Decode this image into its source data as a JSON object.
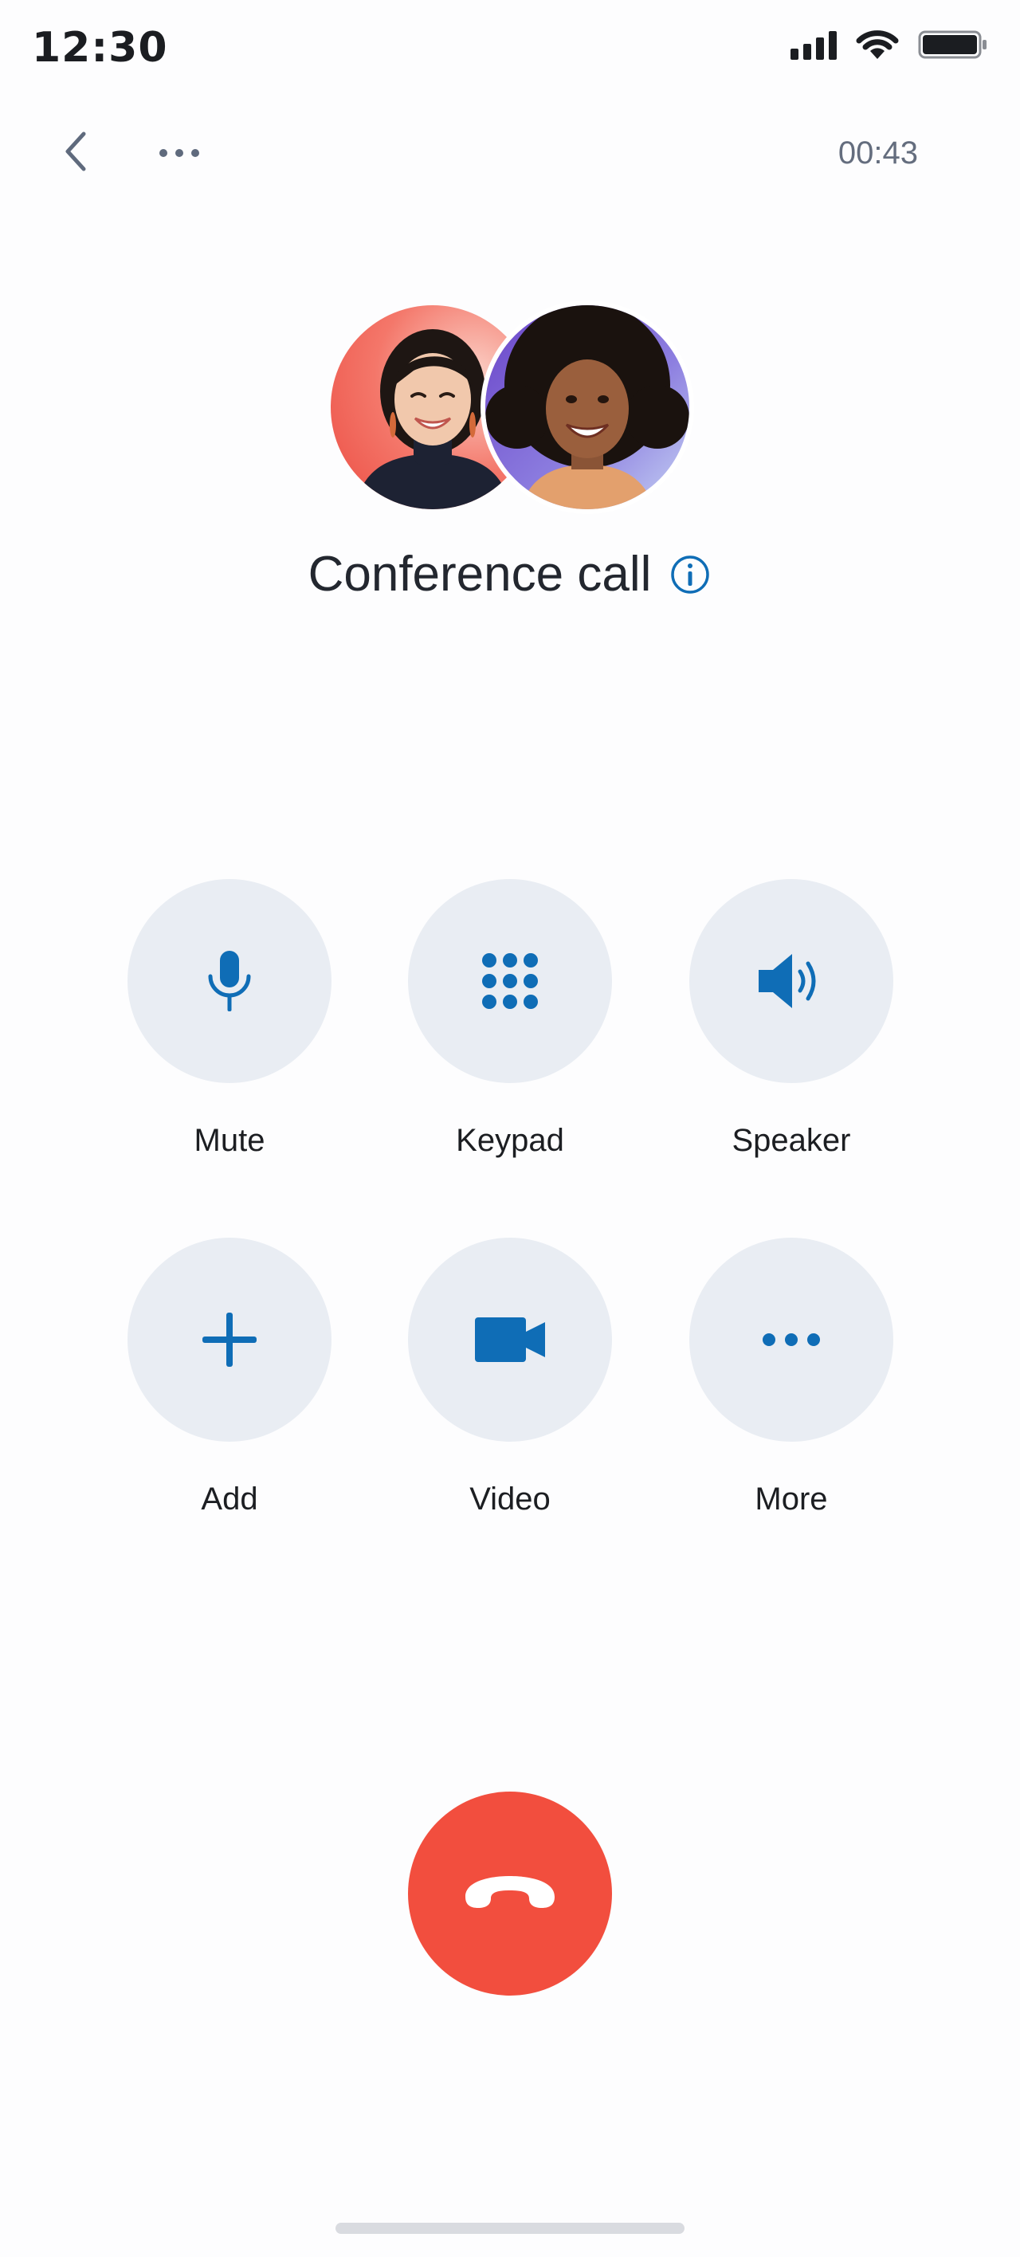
{
  "status_bar": {
    "time": "12:30",
    "icons": [
      "cellular-signal-icon",
      "wifi-icon",
      "battery-icon"
    ]
  },
  "nav": {
    "back_icon": "chevron-left-icon",
    "more_icon": "more-horizontal-icon",
    "timer": "00:43"
  },
  "call": {
    "title": "Conference call",
    "info_icon": "info-icon",
    "participants": [
      "participant-avatar-1",
      "participant-avatar-2"
    ]
  },
  "controls": [
    {
      "label": "Mute",
      "icon": "microphone-icon"
    },
    {
      "label": "Keypad",
      "icon": "keypad-icon"
    },
    {
      "label": "Speaker",
      "icon": "speaker-icon"
    },
    {
      "label": "Add",
      "icon": "plus-icon"
    },
    {
      "label": "Video",
      "icon": "video-camera-icon"
    },
    {
      "label": "More",
      "icon": "more-horizontal-icon"
    }
  ],
  "end_call": {
    "icon": "hang-up-icon"
  },
  "colors": {
    "accent": "#0f6db6",
    "end_call": "#f24e3e",
    "control_bg": "#e9edf3",
    "text": "#23272f",
    "muted_text": "#646d7e"
  }
}
